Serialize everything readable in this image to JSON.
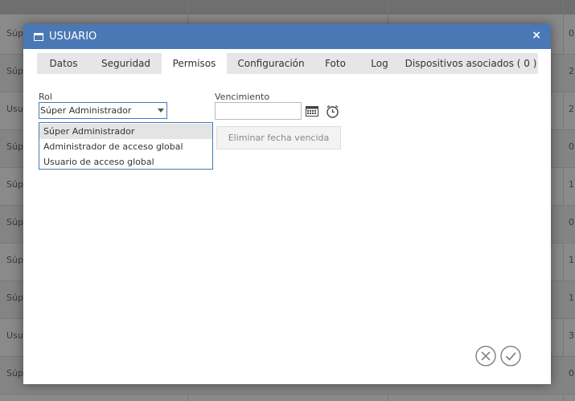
{
  "background": {
    "left_texts": [
      "Súp",
      "Súp",
      "Usu",
      "Súp",
      "Súp",
      "Súp",
      "Súp",
      "Súp",
      "Usu",
      "Súp"
    ],
    "right_texts": [
      "0",
      "2",
      "2",
      "0",
      "1",
      "0",
      "1",
      "1",
      "3",
      "0"
    ]
  },
  "dialog": {
    "title": "USUARIO",
    "close_label": "×",
    "tabs": [
      {
        "label": "Datos"
      },
      {
        "label": "Seguridad"
      },
      {
        "label": "Permisos"
      },
      {
        "label": "Configuración"
      },
      {
        "label": "Foto"
      },
      {
        "label": "Log"
      },
      {
        "label": "Dispositivos asociados ( 0 )"
      }
    ],
    "active_tab": "Permisos",
    "rol": {
      "label": "Rol",
      "value": "Súper Administrador",
      "options": [
        "Súper Administrador",
        "Administrador de acceso global",
        "Usuario de acceso global"
      ]
    },
    "vencimiento": {
      "label": "Vencimiento",
      "value": ""
    },
    "eliminar_button": "Eliminar fecha vencida"
  },
  "colors": {
    "header": "#4a78b5",
    "accent_border": "#4a78b5"
  }
}
